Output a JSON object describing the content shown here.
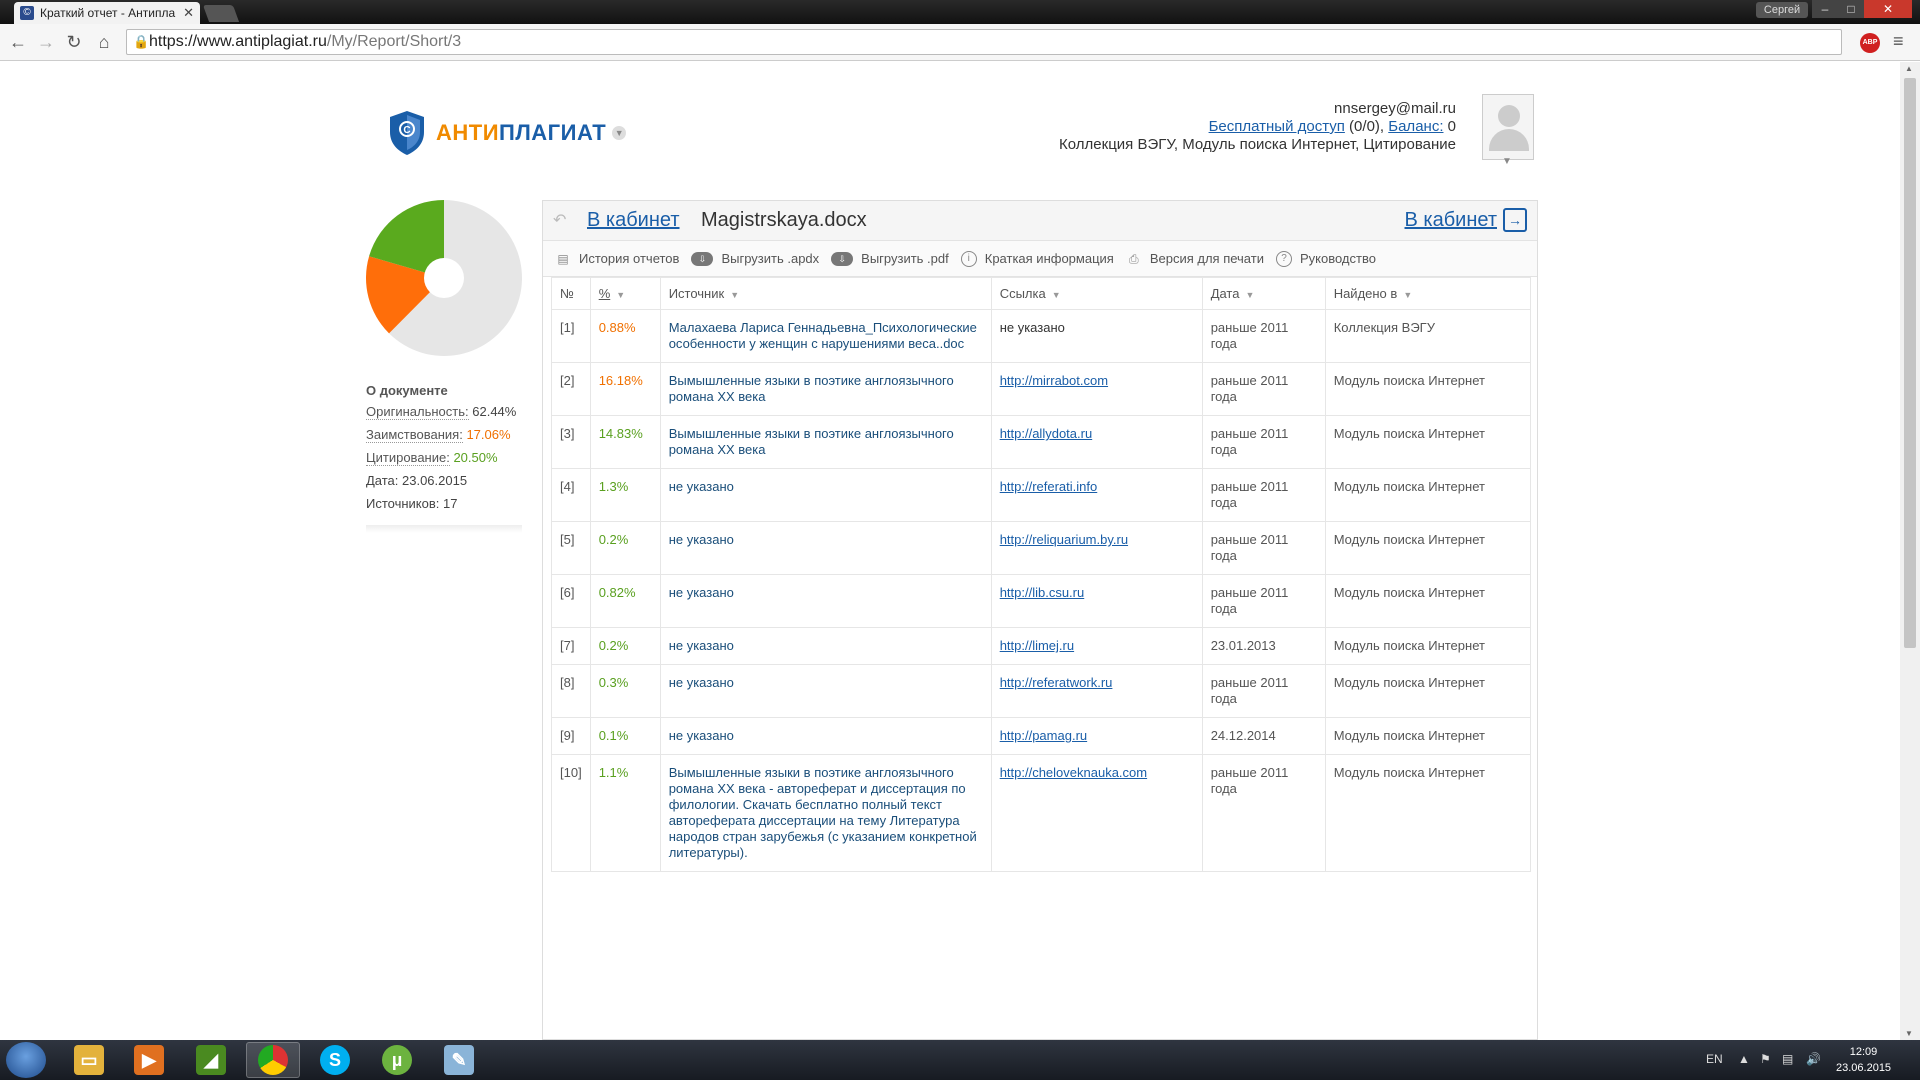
{
  "browser": {
    "tab_title": "Краткий отчет - Антипла",
    "tab_close": "✕",
    "profile_name": "Сергей",
    "url_host": "https://www.antiplagiat.ru",
    "url_path": "/My/Report/Short/3"
  },
  "header": {
    "brand_part1": "АНТИ",
    "brand_part2": "ПЛАГИАТ",
    "email": "nnsergey@mail.ru",
    "free_access_link": "Бесплатный доступ",
    "free_access_value": " (0/0), ",
    "balance_link": "Баланс:",
    "balance_value": " 0",
    "collections": "Коллекция ВЭГУ, Модуль поиска Интернет, Цитирование"
  },
  "sidebar": {
    "about_title": "О документе",
    "originality_label": "Оригинальность:",
    "originality_value": "62.44%",
    "borrowing_label": "Заимствования:",
    "borrowing_value": "17.06%",
    "citation_label": "Цитирование:",
    "citation_value": "20.50%",
    "date_text": "Дата: 23.06.2015",
    "sources_text": "Источников: 17"
  },
  "pie_chart": {
    "slices": [
      {
        "label": "Оригинальность",
        "value": 62.44,
        "color": "#e6e6e6"
      },
      {
        "label": "Заимствования",
        "value": 17.06,
        "color": "#ff6e0a"
      },
      {
        "label": "Цитирование",
        "value": 20.5,
        "color": "#5aaa1e"
      }
    ]
  },
  "report": {
    "back_link": "В кабинет",
    "doc_name": "Magistrskaya.docx",
    "back_link_right": "В кабинет",
    "actions": [
      {
        "label": "История отчетов",
        "icon": "document-icon"
      },
      {
        "label": "Выгрузить .apdx",
        "icon": "cloud-download-icon"
      },
      {
        "label": "Выгрузить .pdf",
        "icon": "cloud-download-icon"
      },
      {
        "label": "Краткая информация",
        "icon": "info-icon"
      },
      {
        "label": "Версия для печати",
        "icon": "printer-icon"
      },
      {
        "label": "Руководство",
        "icon": "help-icon"
      }
    ],
    "columns": [
      "№",
      "%",
      "Источник",
      "Ссылка",
      "Дата",
      "Найдено в"
    ],
    "rows": [
      {
        "num": "[1]",
        "pct": "0.88%",
        "color": "orange",
        "source": "Малахаева Лариса Геннадьевна_Психологические особенности у женщин с нарушениями веса..doc",
        "link": "не указано",
        "date": "раньше 2011 года",
        "found": "Коллекция ВЭГУ"
      },
      {
        "num": "[2]",
        "pct": "16.18%",
        "color": "orange",
        "source": "Вымышленные языки в поэтике англоязычного романа XX века",
        "link": "http://mirrabot.com",
        "date": "раньше 2011 года",
        "found": "Модуль поиска Интернет"
      },
      {
        "num": "[3]",
        "pct": "14.83%",
        "color": "green",
        "source": "Вымышленные языки в поэтике англоязычного романа XX века",
        "link": "http://allydota.ru",
        "date": "раньше 2011 года",
        "found": "Модуль поиска Интернет"
      },
      {
        "num": "[4]",
        "pct": "1.3%",
        "color": "green",
        "source": "не указано",
        "link": "http://referati.info",
        "date": "раньше 2011 года",
        "found": "Модуль поиска Интернет"
      },
      {
        "num": "[5]",
        "pct": "0.2%",
        "color": "green",
        "source": "не указано",
        "link": "http://reliquarium.by.ru",
        "date": "раньше 2011 года",
        "found": "Модуль поиска Интернет"
      },
      {
        "num": "[6]",
        "pct": "0.82%",
        "color": "green",
        "source": "не указано",
        "link": "http://lib.csu.ru",
        "date": "раньше 2011 года",
        "found": "Модуль поиска Интернет"
      },
      {
        "num": "[7]",
        "pct": "0.2%",
        "color": "green",
        "source": "не указано",
        "link": "http://limej.ru",
        "date": "23.01.2013",
        "found": "Модуль поиска Интернет"
      },
      {
        "num": "[8]",
        "pct": "0.3%",
        "color": "green",
        "source": "не указано",
        "link": "http://referatwork.ru",
        "date": "раньше 2011 года",
        "found": "Модуль поиска Интернет"
      },
      {
        "num": "[9]",
        "pct": "0.1%",
        "color": "green",
        "source": "не указано",
        "link": "http://pamag.ru",
        "date": "24.12.2014",
        "found": "Модуль поиска Интернет"
      },
      {
        "num": "[10]",
        "pct": "1.1%",
        "color": "green",
        "source": "Вымышленные языки в поэтике англоязычного романа XX века - автореферат и диссертация по филологии. Скачать бесплатно полный текст автореферата диссертации на тему Литература народов стран зарубежья (с указанием конкретной литературы).",
        "link": "http://cheloveknauka.com",
        "date": "раньше 2011 года",
        "found": "Модуль поиска Интернет"
      }
    ]
  },
  "taskbar": {
    "lang": "EN",
    "time": "12:09",
    "date": "23.06.2015"
  },
  "colors": {
    "brand_orange": "#f08a00",
    "brand_blue": "#1a5ea8",
    "borrowing": "#f07000",
    "citation": "#5aa020"
  }
}
